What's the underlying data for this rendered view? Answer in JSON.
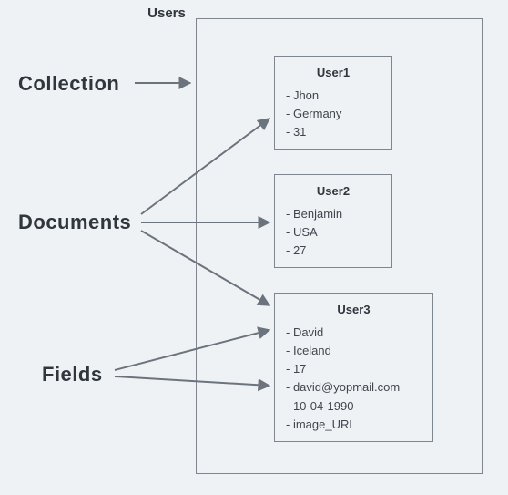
{
  "labels": {
    "collection": "Collection",
    "documents": "Documents",
    "fields": "Fields"
  },
  "container_title": "Users",
  "users": [
    {
      "title": "User1",
      "fields": [
        "Jhon",
        "Germany",
        "31"
      ]
    },
    {
      "title": "User2",
      "fields": [
        "Benjamin",
        "USA",
        "27"
      ]
    },
    {
      "title": "User3",
      "fields": [
        "David",
        "Iceland",
        "17",
        "david@yopmail.com",
        "10-04-1990",
        "image_URL"
      ]
    }
  ],
  "chart_data": {
    "type": "table",
    "title": "Users collection schema diagram",
    "collection": "Users",
    "documents": [
      {
        "id": "User1",
        "name": "Jhon",
        "country": "Germany",
        "age": 31
      },
      {
        "id": "User2",
        "name": "Benjamin",
        "country": "USA",
        "age": 27
      },
      {
        "id": "User3",
        "name": "David",
        "country": "Iceland",
        "age": 17,
        "email": "david@yopmail.com",
        "dob": "10-04-1990",
        "image": "image_URL"
      }
    ],
    "label_map": {
      "Collection": "Users container",
      "Documents": [
        "User1",
        "User2",
        "User3"
      ],
      "Fields": "fields of User3"
    }
  }
}
